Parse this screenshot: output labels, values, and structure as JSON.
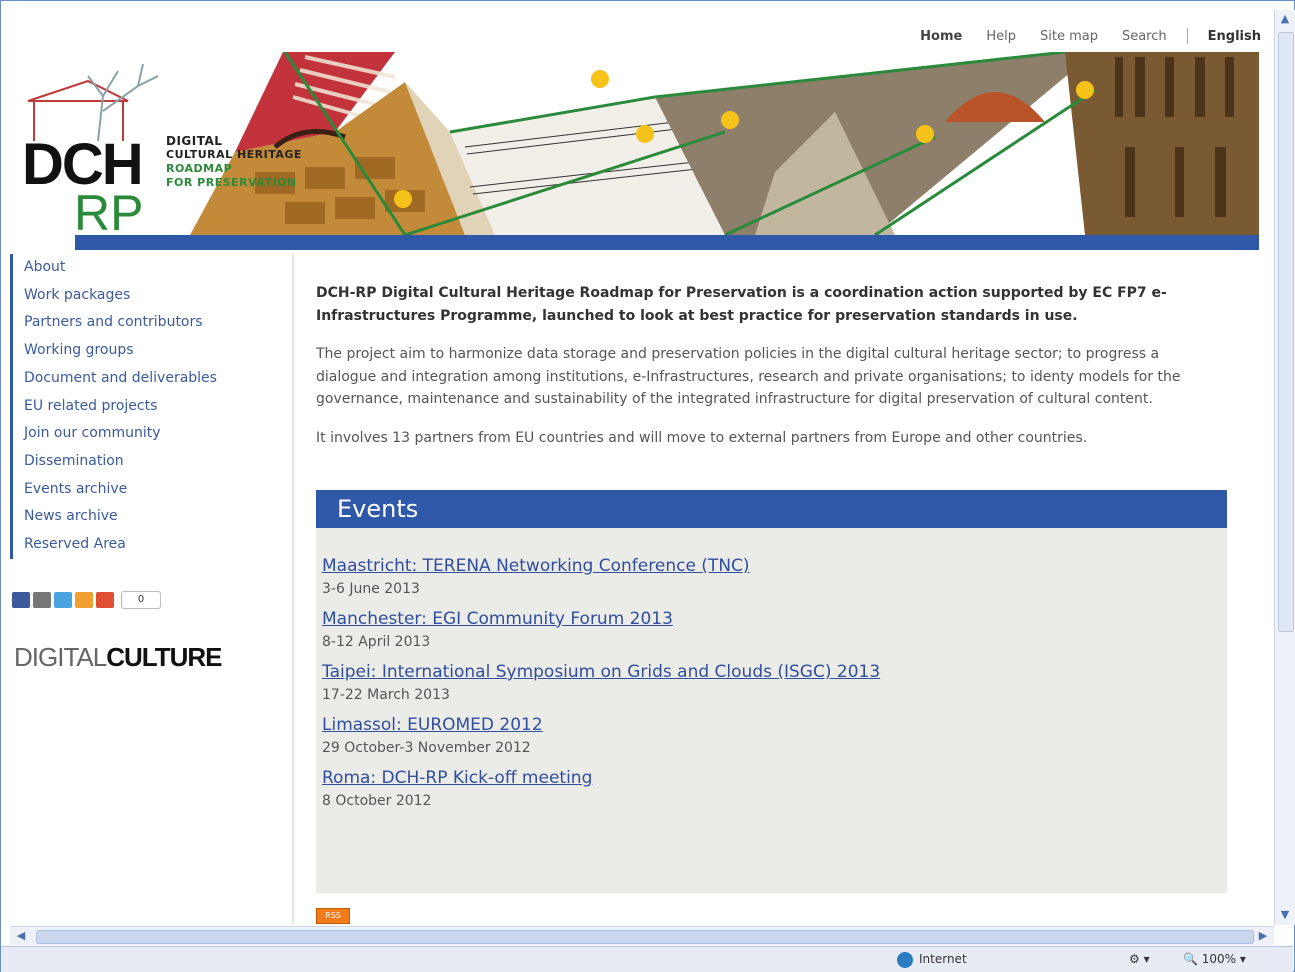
{
  "top_nav": {
    "home": "Home",
    "help": "Help",
    "site_map": "Site map",
    "search": "Search",
    "language": "English"
  },
  "logo": {
    "dch": "DCH",
    "rp": "RP",
    "line1": "DIGITAL",
    "line2": "CULTURAL HERITAGE",
    "line3": "ROADMAP",
    "line4": "FOR PRESERVATION"
  },
  "sidebar": {
    "items": [
      {
        "label": "About"
      },
      {
        "label": "Work packages"
      },
      {
        "label": "Partners and contributors"
      },
      {
        "label": "Working groups"
      },
      {
        "label": "Document and deliverables"
      },
      {
        "label": "EU related projects"
      },
      {
        "label": "Join our community"
      },
      {
        "label": "Dissemination"
      },
      {
        "label": "Events archive"
      },
      {
        "label": "News archive"
      },
      {
        "label": "Reserved Area"
      }
    ],
    "share_count": "0",
    "digital_culture_a": "DIGITAL",
    "digital_culture_b": "CULTURE"
  },
  "main": {
    "intro": "DCH-RP Digital Cultural Heritage Roadmap for Preservation is a coordination action supported by EC FP7 e-Infrastructures Programme, launched to look at best practice for preservation standards in use.",
    "aim": "The project aim to harmonize data storage and preservation policies in the digital cultural heritage sector; to progress a dialogue and integration among institutions, e-Infrastructures, research and private organisations; to identy models for the governance, maintenance and sustainability of the integrated  infrastructure for digital preservation of cultural content.",
    "partners": "It involves 13 partners from EU countries and will move to external partners from Europe and other countries."
  },
  "events": {
    "heading": "Events",
    "items": [
      {
        "title": "Maastricht: TERENA Networking Conference (TNC)",
        "date": "3-6 June 2013"
      },
      {
        "title": "Manchester: EGI Community Forum 2013",
        "date": "8-12 April 2013"
      },
      {
        "title": "Taipei: International Symposium on Grids and Clouds (ISGC) 2013",
        "date": "17-22 March 2013"
      },
      {
        "title": "Limassol: EUROMED 2012",
        "date": "29 October-3 November 2012"
      },
      {
        "title": "Roma: DCH-RP Kick-off meeting",
        "date": "8 October 2012"
      }
    ],
    "rss_label": "RSS"
  },
  "statusbar": {
    "zone": "Internet",
    "zoom": "100%"
  },
  "colors": {
    "accent_blue": "#2f58a8",
    "link_blue": "#3a5b9a",
    "logo_green": "#2a8a3a",
    "events_bg": "#ebebe8",
    "rss_orange": "#f07b1a"
  }
}
